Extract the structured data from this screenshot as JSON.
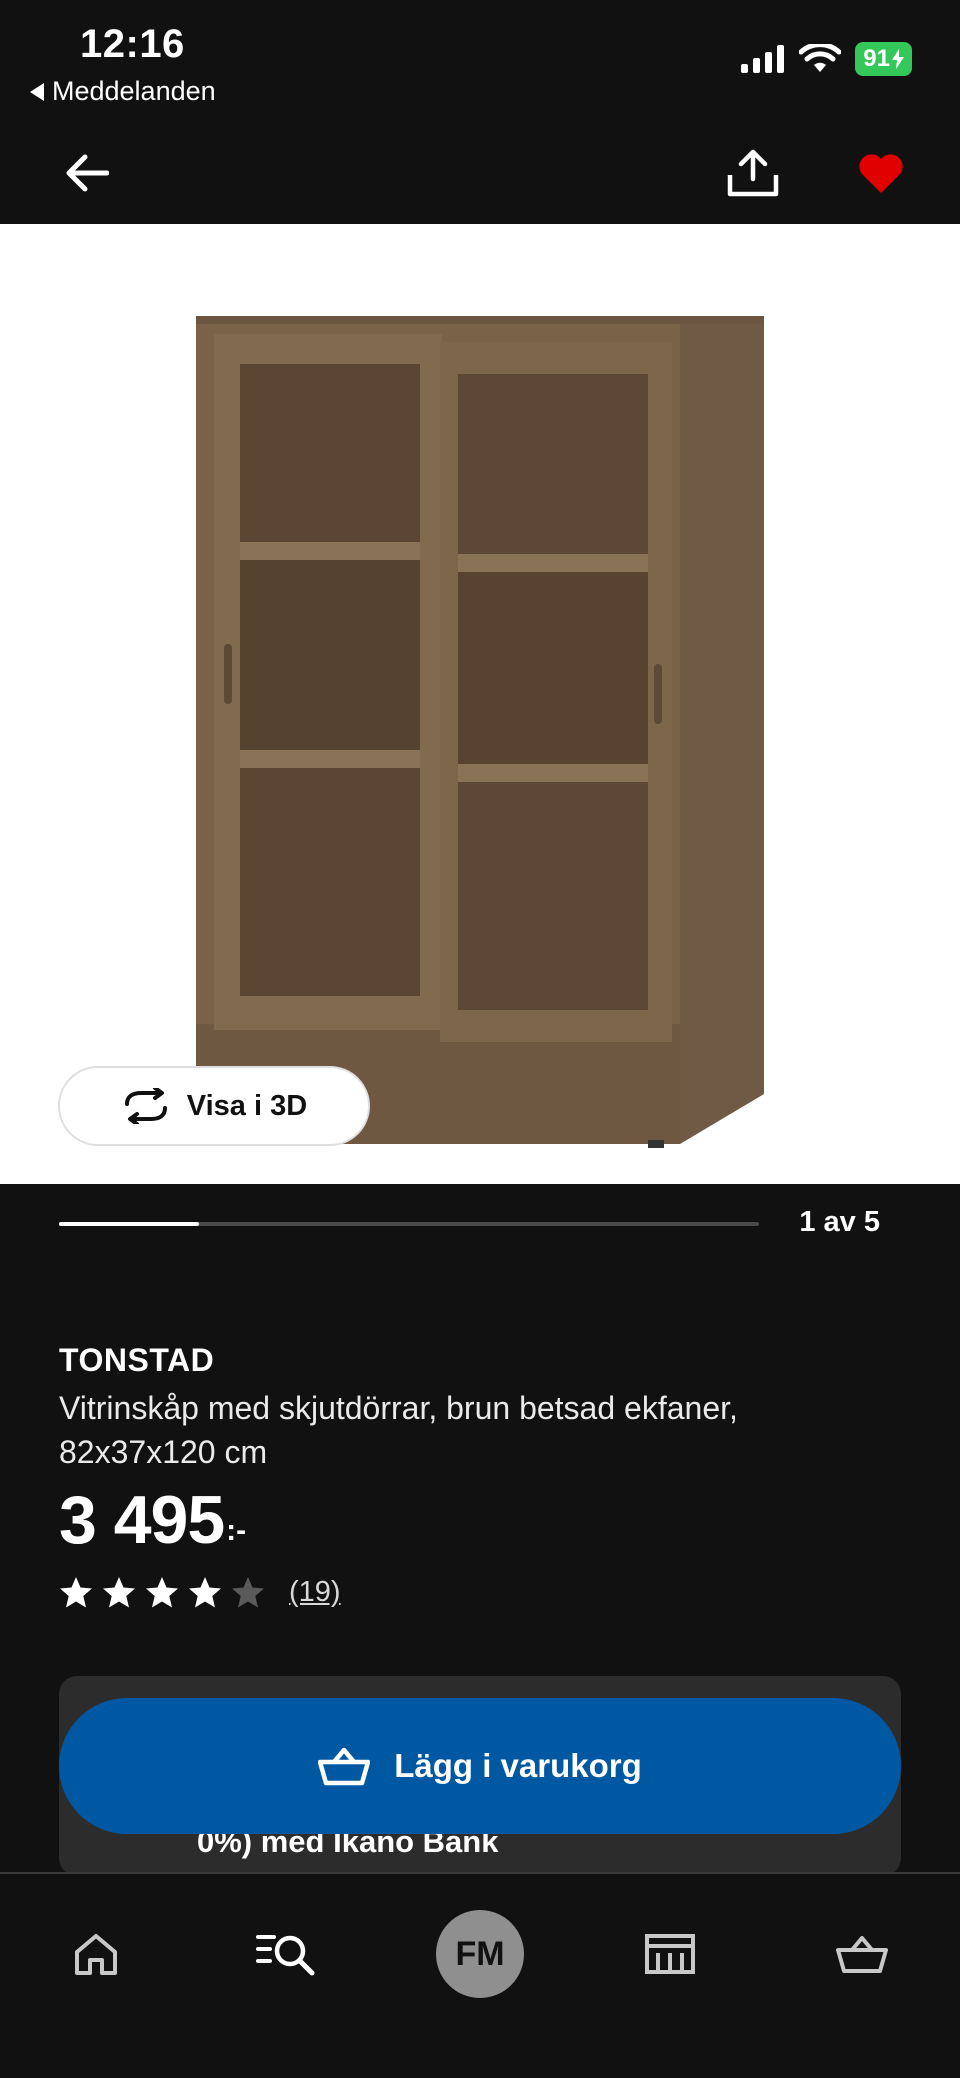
{
  "status_bar": {
    "time": "12:16",
    "back_app_label": "Meddelanden",
    "battery_level": "91"
  },
  "header": {
    "back_icon": "arrow-left-icon",
    "share_icon": "share-icon",
    "favorite_icon": "heart-icon",
    "favorite_active": true,
    "favorite_color": "#e00000"
  },
  "gallery": {
    "view_3d_label": "Visa i 3D",
    "current": 1,
    "total": 5,
    "counter_text": "1 av 5",
    "progress": 0.2
  },
  "product": {
    "brand": "TONSTAD",
    "description": "Vitrinskåp med skjutdörrar, brun betsad ekfaner, 82x37x120 cm",
    "price_integer": "3 495",
    "price_suffix": ":-",
    "rating": 4,
    "rating_max": 5,
    "review_count": "(19)"
  },
  "financing": {
    "text_visible": "0%) med Ikano Bank"
  },
  "cta": {
    "label": "Lägg i varukorg",
    "icon": "basket-icon",
    "color": "#0058a3"
  },
  "bottom_nav": {
    "items": [
      {
        "name": "home",
        "icon": "home-icon"
      },
      {
        "name": "search",
        "icon": "search-list-icon"
      },
      {
        "name": "profile",
        "initials": "FM"
      },
      {
        "name": "store",
        "icon": "store-icon"
      },
      {
        "name": "cart",
        "icon": "basket-icon"
      }
    ]
  }
}
